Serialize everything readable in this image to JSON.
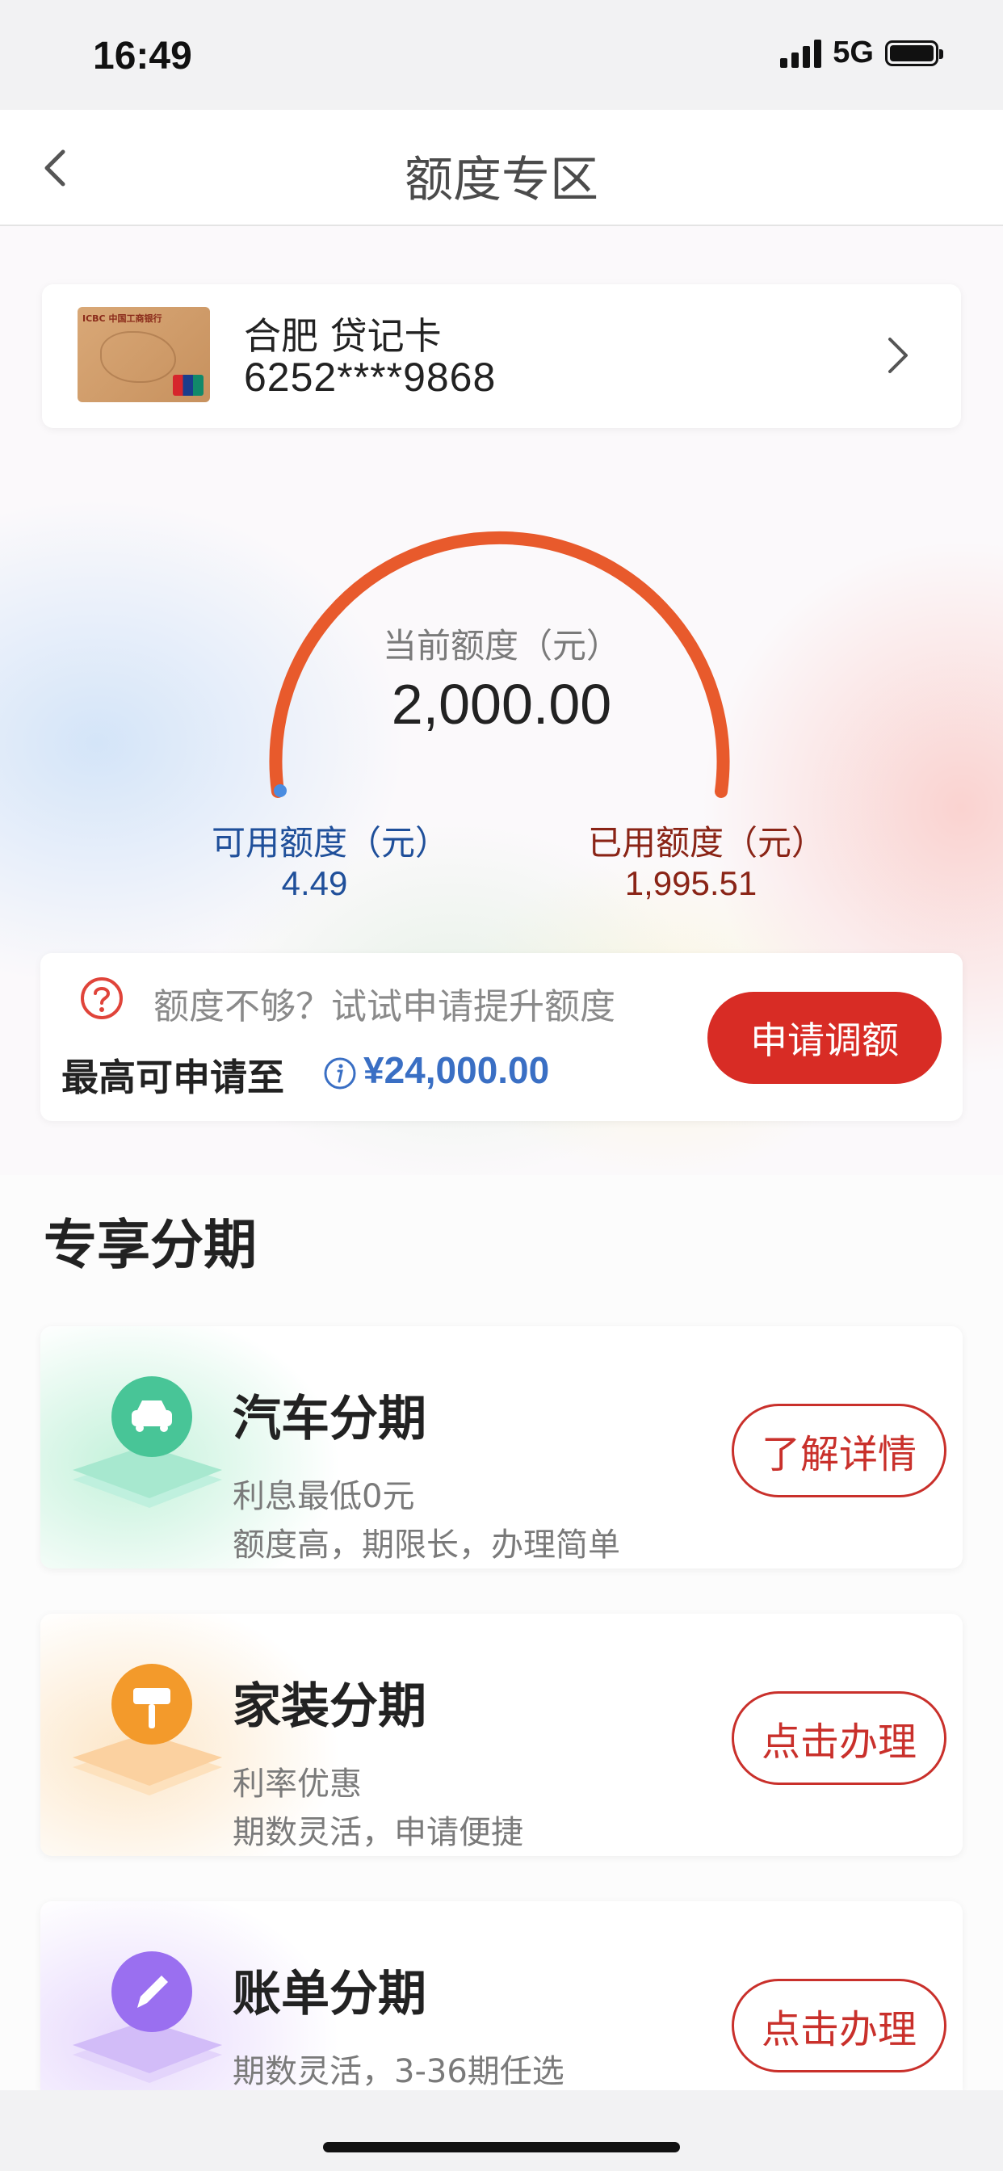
{
  "status_bar": {
    "time": "16:49",
    "network": "5G"
  },
  "nav": {
    "title": "额度专区"
  },
  "card": {
    "name": "合肥 贷记卡",
    "number": "6252****9868"
  },
  "gauge": {
    "current_label": "当前额度（元）",
    "current_value": "2,000.00",
    "available_label": "可用额度（元）",
    "available_value": "4.49",
    "used_label": "已用额度（元）",
    "used_value": "1,995.51",
    "used_fraction": 0.998
  },
  "promo": {
    "text": "额度不够？试试申请提升额度",
    "max_label": "最高可申请至",
    "max_amount": "¥24,000.00",
    "button": "申请调额"
  },
  "section": {
    "title": "专享分期",
    "items": [
      {
        "title": "汽车分期",
        "sub1": "利息最低0元",
        "sub2": "额度高，期限长，办理简单",
        "button": "了解详情",
        "icon": "car-icon",
        "color": "#3fbf8e"
      },
      {
        "title": "家装分期",
        "sub1": "利率优惠",
        "sub2": "期数灵活，申请便捷",
        "button": "点击办理",
        "icon": "paint-roller-icon",
        "color": "#f29a2e"
      },
      {
        "title": "账单分期",
        "sub1": "期数灵活，3-36期任选",
        "sub2": "",
        "button": "点击办理",
        "icon": "pencil-icon",
        "color": "#9a6ff0"
      }
    ]
  },
  "colors": {
    "arc": "#e85a2c",
    "apply": "#d82c25",
    "link_red": "#c9302b",
    "amount_blue": "#3a6fc4"
  }
}
